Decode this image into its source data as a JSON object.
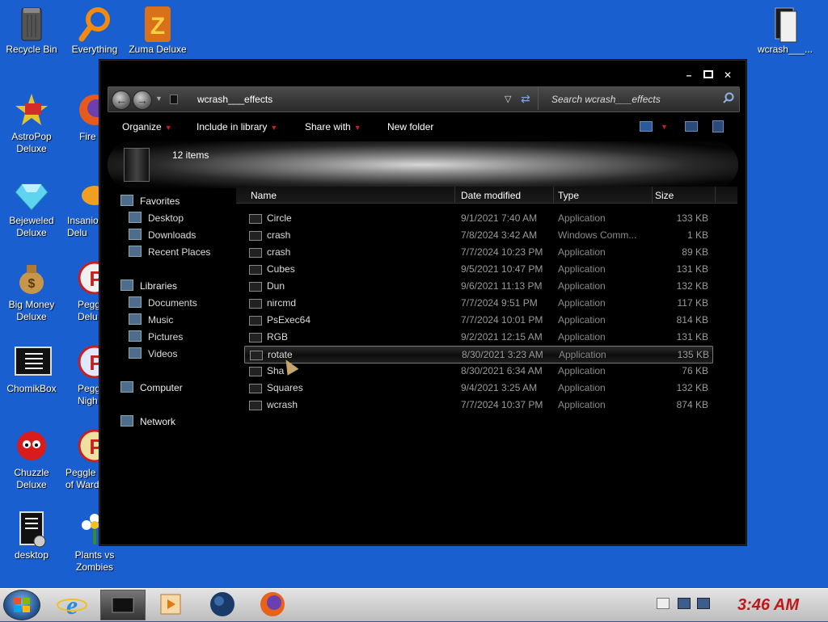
{
  "desktop_icons": [
    {
      "label": "Recycle Bin",
      "icon": "recycle-bin-icon"
    },
    {
      "label": "Everything",
      "icon": "search-magnifier-icon"
    },
    {
      "label": "Zuma Deluxe",
      "icon": "zuma-icon"
    },
    {
      "label": "wcrash___...",
      "icon": "file-icon"
    },
    {
      "label": "AstroPop\nDeluxe",
      "icon": "astropop-icon"
    },
    {
      "label": "Fire",
      "icon": "firefox-icon"
    },
    {
      "label": "Bejeweled\nDeluxe",
      "icon": "gem-icon"
    },
    {
      "label": "Insanio\nDelu",
      "icon": "fish-icon"
    },
    {
      "label": "Big Money\nDeluxe",
      "icon": "money-bag-icon"
    },
    {
      "label": "Pegg\nDelu",
      "icon": "peggle-icon"
    },
    {
      "label": "ChomikBox",
      "icon": "document-icon"
    },
    {
      "label": "Pegg\nNigh",
      "icon": "peggle-icon"
    },
    {
      "label": "Chuzzle\nDeluxe",
      "icon": "chuzzle-icon"
    },
    {
      "label": "Peggle\nof Ward",
      "icon": "peggle-icon"
    },
    {
      "label": "desktop",
      "icon": "desktop-doc-icon"
    },
    {
      "label": "Plants vs\nZombies",
      "icon": "flower-icon"
    }
  ],
  "explorer": {
    "address": "wcrash___effects",
    "search_placeholder": "Search wcrash___effects",
    "toolbar": {
      "organize": "Organize",
      "include": "Include in library",
      "share": "Share with",
      "new_folder": "New folder"
    },
    "item_count": "12 items",
    "nav": {
      "favorites": "Favorites",
      "desktop": "Desktop",
      "downloads": "Downloads",
      "recent": "Recent Places",
      "libraries": "Libraries",
      "documents": "Documents",
      "music": "Music",
      "pictures": "Pictures",
      "videos": "Videos",
      "computer": "Computer",
      "network": "Network"
    },
    "columns": {
      "name": "Name",
      "date": "Date modified",
      "type": "Type",
      "size": "Size"
    },
    "files": [
      {
        "name": "Circle",
        "date": "9/1/2021 7:40 AM",
        "type": "Application",
        "size": "133 KB"
      },
      {
        "name": "crash",
        "date": "7/8/2024 3:42 AM",
        "type": "Windows Comm...",
        "size": "1 KB"
      },
      {
        "name": "crash",
        "date": "7/7/2024 10:23 PM",
        "type": "Application",
        "size": "89 KB"
      },
      {
        "name": "Cubes",
        "date": "9/5/2021 10:47 PM",
        "type": "Application",
        "size": "131 KB"
      },
      {
        "name": "Dun",
        "date": "9/6/2021 11:13 PM",
        "type": "Application",
        "size": "132 KB"
      },
      {
        "name": "nircmd",
        "date": "7/7/2024 9:51 PM",
        "type": "Application",
        "size": "117 KB"
      },
      {
        "name": "PsExec64",
        "date": "7/7/2024 10:01 PM",
        "type": "Application",
        "size": "814 KB"
      },
      {
        "name": "RGB",
        "date": "9/2/2021 12:15 AM",
        "type": "Application",
        "size": "131 KB"
      },
      {
        "name": "rotate",
        "date": "8/30/2021 3:23 AM",
        "type": "Application",
        "size": "135 KB"
      },
      {
        "name": "Sha",
        "date": "8/30/2021 6:34 AM",
        "type": "Application",
        "size": "76 KB"
      },
      {
        "name": "Squares",
        "date": "9/4/2021 3:25 AM",
        "type": "Application",
        "size": "132 KB"
      },
      {
        "name": "wcrash",
        "date": "7/7/2024 10:37 PM",
        "type": "Application",
        "size": "874 KB"
      }
    ]
  },
  "taskbar": {
    "clock": "3:46 AM",
    "icons": [
      "windows-start-icon",
      "internet-explorer-icon",
      "explorer-window-icon",
      "media-player-icon",
      "globe-icon",
      "firefox-icon"
    ]
  },
  "colors": {
    "desktop": "#1a5fd0",
    "clock": "#c01818",
    "accent_arrow": "#c81e1e"
  }
}
